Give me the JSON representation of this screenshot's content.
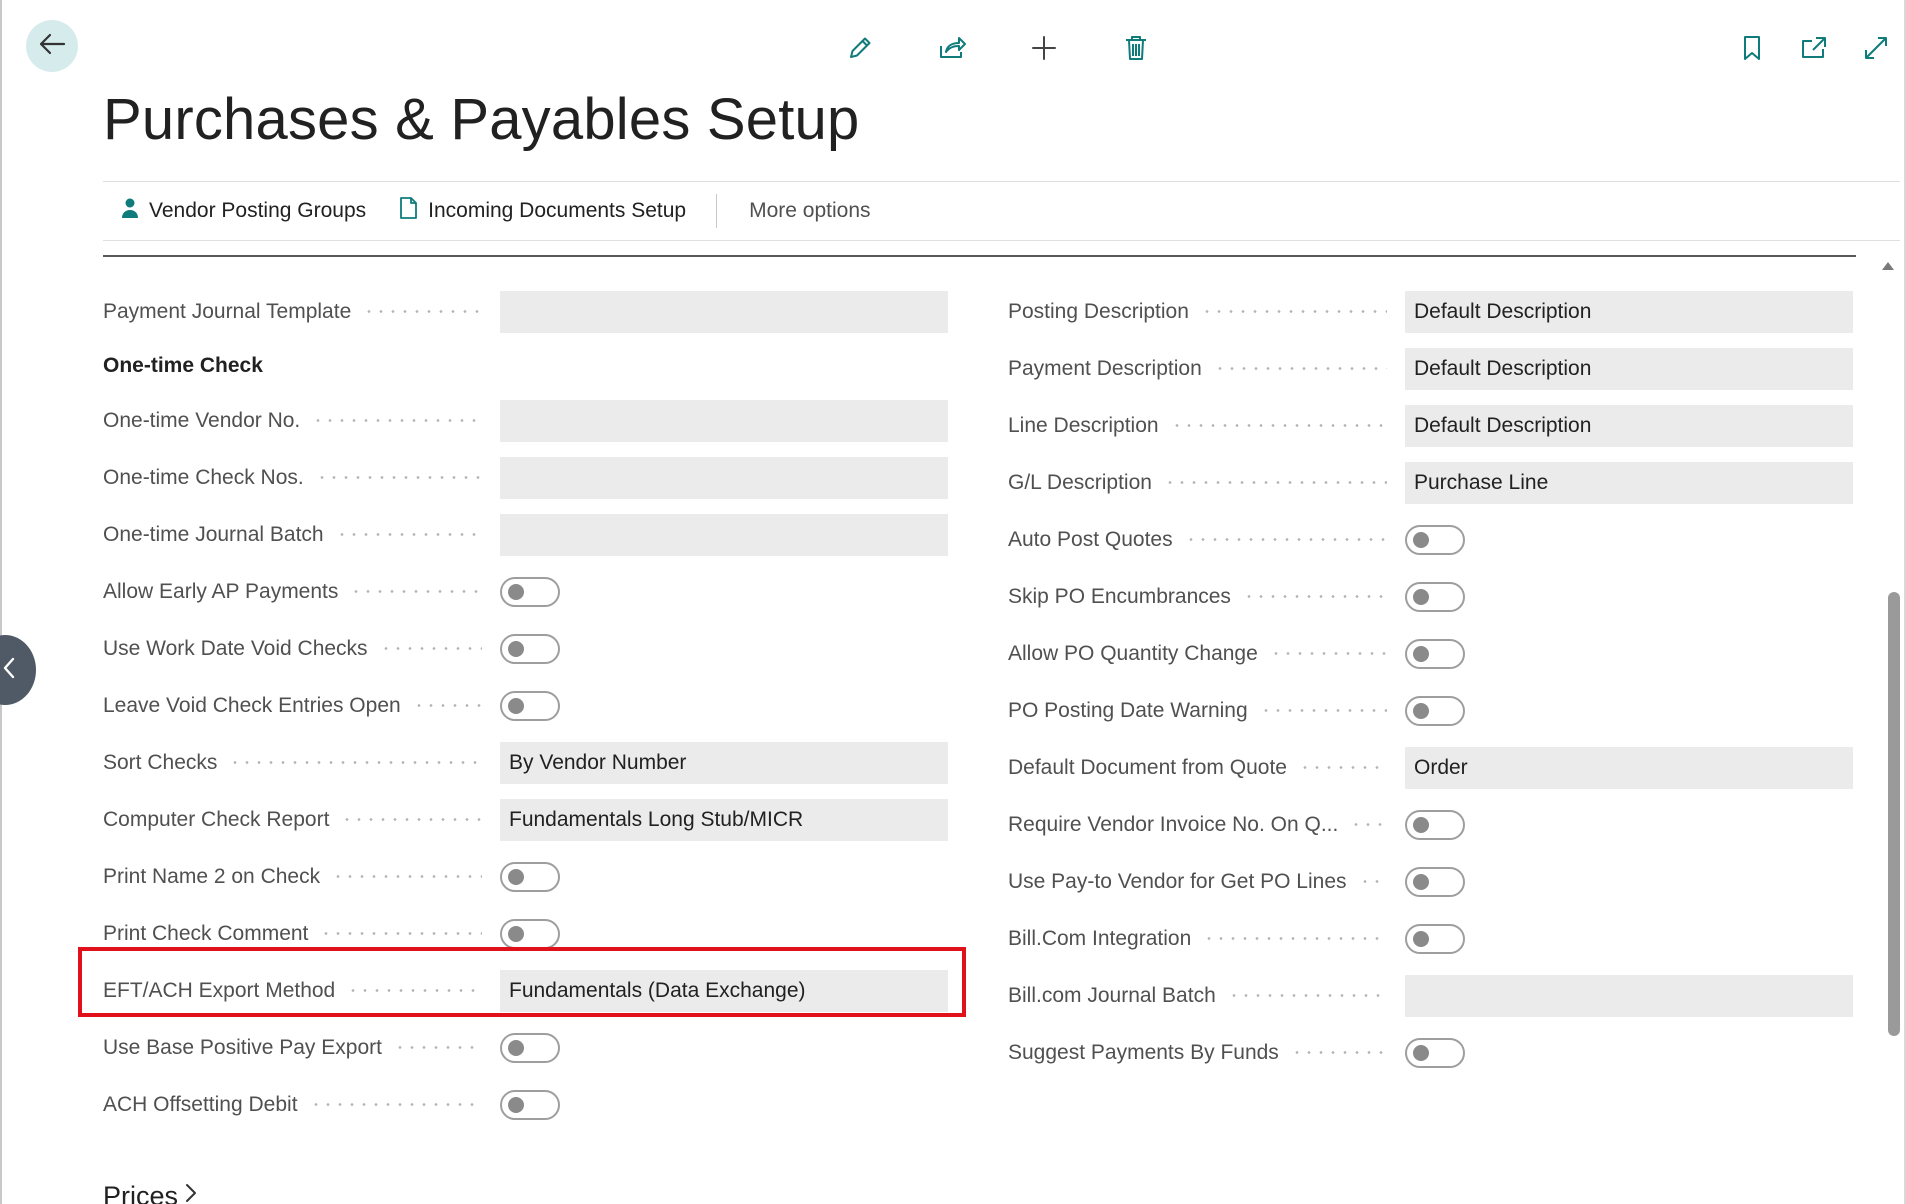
{
  "page": {
    "title": "Purchases & Payables Setup"
  },
  "icons": {
    "back": "arrow-left-icon",
    "collapse": "chevron-left-icon",
    "edit": "pencil-icon",
    "share": "share-icon",
    "new": "plus-icon",
    "delete": "trash-icon",
    "bookmark": "bookmark-icon",
    "open_new": "open-in-new-window-icon",
    "expand": "expand-icon"
  },
  "actions": {
    "vendor_posting_groups": "Vendor Posting Groups",
    "incoming_documents_setup": "Incoming Documents Setup",
    "more_options": "More options"
  },
  "left_column": {
    "payment_journal_template": {
      "label": "Payment Journal Template",
      "value": ""
    },
    "one_time_check_heading": "One-time Check",
    "one_time_vendor_no": {
      "label": "One-time Vendor No.",
      "value": ""
    },
    "one_time_check_nos": {
      "label": "One-time Check Nos.",
      "value": ""
    },
    "one_time_journal_batch": {
      "label": "One-time Journal Batch",
      "value": ""
    },
    "allow_early_ap_payments": {
      "label": "Allow Early AP Payments",
      "on": false
    },
    "use_work_date_void_checks": {
      "label": "Use Work Date Void Checks",
      "on": false
    },
    "leave_void_check_entries_open": {
      "label": "Leave Void Check Entries Open",
      "on": false
    },
    "sort_checks": {
      "label": "Sort Checks",
      "value": "By Vendor Number"
    },
    "computer_check_report": {
      "label": "Computer Check Report",
      "value": "Fundamentals Long Stub/MICR"
    },
    "print_name_2_on_check": {
      "label": "Print Name 2 on Check",
      "on": false
    },
    "print_check_comment": {
      "label": "Print Check Comment",
      "on": false
    },
    "eft_ach_export_method": {
      "label": "EFT/ACH Export Method",
      "value": "Fundamentals (Data Exchange)"
    },
    "use_base_positive_pay_export": {
      "label": "Use Base Positive Pay Export",
      "on": false
    },
    "ach_offsetting_debit": {
      "label": "ACH Offsetting Debit",
      "on": false
    }
  },
  "right_column": {
    "posting_description": {
      "label": "Posting Description",
      "value": "Default Description"
    },
    "payment_description": {
      "label": "Payment Description",
      "value": "Default Description"
    },
    "line_description": {
      "label": "Line Description",
      "value": "Default Description"
    },
    "gl_description": {
      "label": "G/L Description",
      "value": "Purchase Line"
    },
    "auto_post_quotes": {
      "label": "Auto Post Quotes",
      "on": false
    },
    "skip_po_encumbrances": {
      "label": "Skip PO Encumbrances",
      "on": false
    },
    "allow_po_quantity_change": {
      "label": "Allow PO Quantity Change",
      "on": false
    },
    "po_posting_date_warning": {
      "label": "PO Posting Date Warning",
      "on": false
    },
    "default_document_from_quote": {
      "label": "Default Document from Quote",
      "value": "Order"
    },
    "require_vendor_invoice_no": {
      "label": "Require Vendor Invoice No. On Q...",
      "on": false
    },
    "use_pay_to_vendor": {
      "label": "Use Pay-to Vendor for Get PO Lines",
      "on": false
    },
    "bill_com_integration": {
      "label": "Bill.Com Integration",
      "on": false
    },
    "bill_com_journal_batch": {
      "label": "Bill.com Journal Batch",
      "value": ""
    },
    "suggest_payments_by_funds": {
      "label": "Suggest Payments By Funds",
      "on": false
    }
  },
  "sections": {
    "prices": "Prices"
  },
  "colors": {
    "accent": "#00807f",
    "highlight": "#e0111a",
    "field_bg": "#ebebeb"
  }
}
